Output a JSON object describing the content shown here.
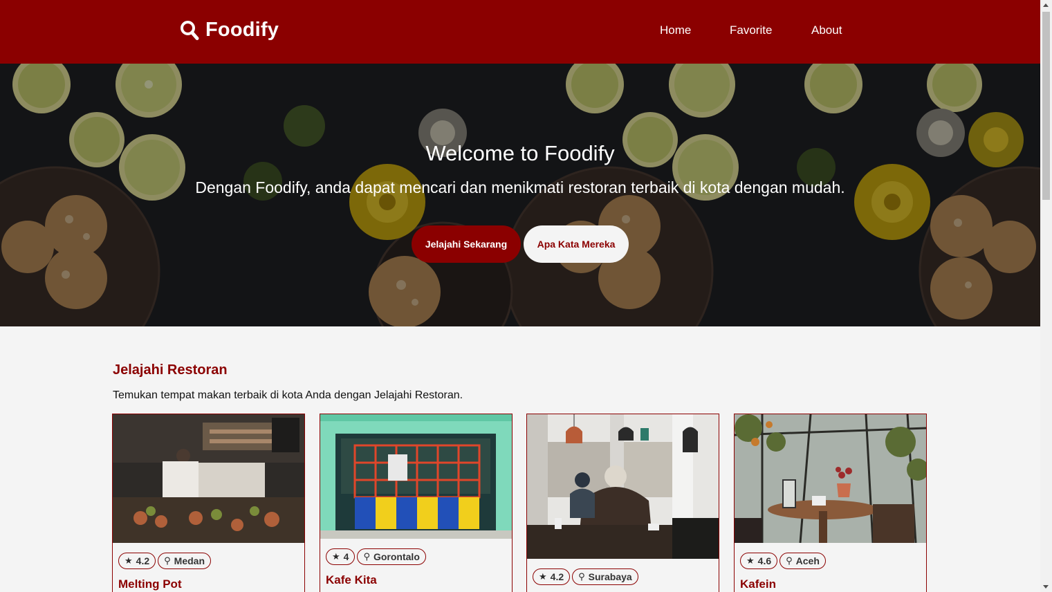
{
  "header": {
    "brand": "Foodify",
    "nav": {
      "home": "Home",
      "favorite": "Favorite",
      "about": "About"
    },
    "color": "#8b0000"
  },
  "hero": {
    "title": "Welcome to Foodify",
    "subtitle": "Dengan Foodify, anda dapat mencari dan menikmati restoran terbaik di kota dengan mudah.",
    "primary_button": "Jelajahi Sekarang",
    "secondary_button": "Apa Kata Mereka"
  },
  "explore": {
    "title": "Jelajahi Restoran",
    "description": "Temukan tempat makan terbaik di kota Anda dengan Jelajahi Restoran."
  },
  "restaurants": [
    {
      "name": "Melting Pot",
      "rating": "4.2",
      "city": "Medan"
    },
    {
      "name": "Kafe Kita",
      "rating": "4",
      "city": "Gorontalo"
    },
    {
      "name": "",
      "rating": "4.2",
      "city": "Surabaya"
    },
    {
      "name": "Kafein",
      "rating": "4.6",
      "city": "Aceh"
    }
  ],
  "icons": {
    "brand": "search-icon",
    "rating": "star-icon",
    "location": "map-pin-icon"
  }
}
